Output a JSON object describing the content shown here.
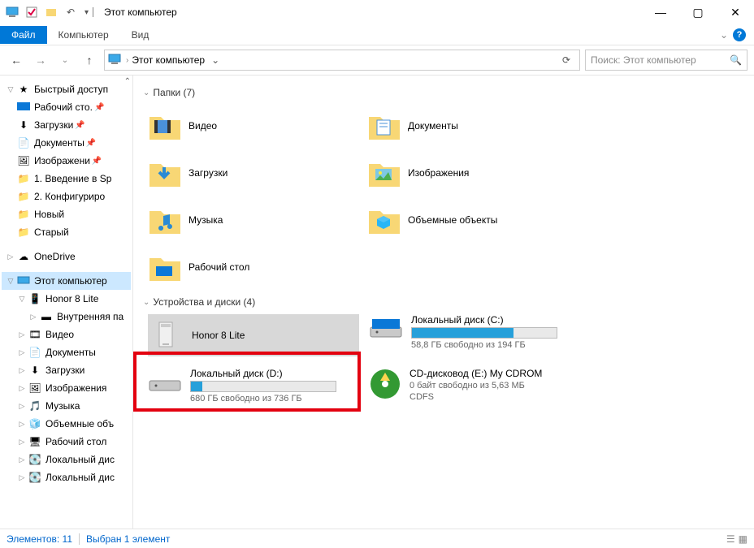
{
  "window": {
    "title": "Этот компьютер",
    "minimize": "—",
    "maximize": "▢",
    "close": "✕"
  },
  "ribbon": {
    "file": "Файл",
    "computer": "Компьютер",
    "view": "Вид",
    "help": "?"
  },
  "nav": {
    "breadcrumb": "Этот компьютер",
    "search_placeholder": "Поиск: Этот компьютер"
  },
  "tree": {
    "quick_access": "Быстрый доступ",
    "desktop": "Рабочий сто.",
    "downloads": "Загрузки",
    "documents": "Документы",
    "pictures": "Изображени",
    "folder_intro": "1. Введение в Sp",
    "folder_config": "2. Конфигуриро",
    "folder_new": "Новый",
    "folder_old": "Старый",
    "onedrive": "OneDrive",
    "this_pc": "Этот компьютер",
    "honor": "Honor 8 Lite",
    "internal": "Внутренняя па",
    "video": "Видео",
    "documents2": "Документы",
    "downloads2": "Загрузки",
    "pictures2": "Изображения",
    "music": "Музыка",
    "objects3d": "Объемные объ",
    "desktop2": "Рабочий стол",
    "localdisk1": "Локальный дис",
    "localdisk2": "Локальный дис"
  },
  "groups": {
    "folders": "Папки (7)",
    "devices": "Устройства и диски (4)"
  },
  "folders": {
    "video": "Видео",
    "documents": "Документы",
    "downloads": "Загрузки",
    "pictures": "Изображения",
    "music": "Музыка",
    "objects3d": "Объемные объекты",
    "desktop": "Рабочий стол"
  },
  "drives": {
    "honor": {
      "name": "Honor 8 Lite"
    },
    "c": {
      "name": "Локальный диск (C:)",
      "free": "58,8 ГБ свободно из 194 ГБ",
      "fill_pct": 70
    },
    "d": {
      "name": "Локальный диск (D:)",
      "free": "680 ГБ свободно из 736 ГБ",
      "fill_pct": 8
    },
    "e": {
      "name": "CD-дисковод (E:) My CDROM",
      "free": "0 байт свободно из 5,63 МБ",
      "fs": "CDFS"
    }
  },
  "status": {
    "elements": "Элементов: 11",
    "selected": "Выбран 1 элемент"
  }
}
